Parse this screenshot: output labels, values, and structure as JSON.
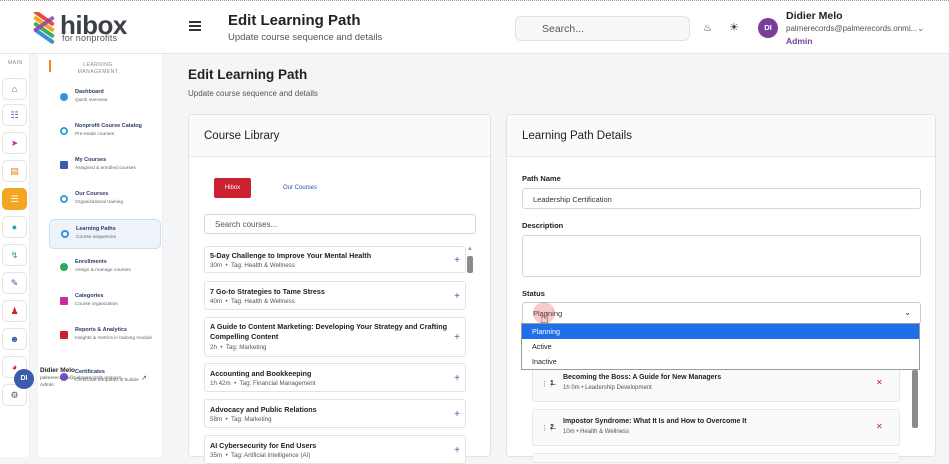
{
  "header": {
    "logo_text": "hibox",
    "logo_tag": "for nonprofits",
    "title": "Edit Learning Path",
    "subtitle": "Update course sequence and details",
    "search_placeholder": "Search...",
    "user_initials": "DI",
    "user_name": "Didier Melo",
    "user_email": "palmerecords@palmerecords.onmi...",
    "user_role": "Admin"
  },
  "rail": {
    "label": "MAIN",
    "icons": [
      "home-icon",
      "sitemap-icon",
      "rocket-icon",
      "book-icon",
      "layers-icon",
      "target-icon",
      "flow-icon",
      "form-icon",
      "user-minus-icon",
      "users-icon",
      "chart-pie-icon",
      "gear-icon"
    ]
  },
  "sidenav": {
    "heading": "LEARNING MANAGEMENT",
    "items": [
      {
        "title": "Dashboard",
        "sub": "Quick overview",
        "color": "#3b8fd9",
        "active": false
      },
      {
        "title": "Nonprofit Course Catalog",
        "sub": "Pre-made courses",
        "color": "#2fa4d6",
        "active": false
      },
      {
        "title": "My Courses",
        "sub": "Assigned & enrolled courses",
        "color": "#3b5bab",
        "active": false
      },
      {
        "title": "Our Courses",
        "sub": "Organizational training",
        "color": "#2fa4d6",
        "active": false
      },
      {
        "title": "Learning Paths",
        "sub": "Course sequences",
        "color": "#3b8fd9",
        "active": true
      },
      {
        "title": "Enrollments",
        "sub": "Assign & manage courses",
        "color": "#2fa85a",
        "active": false
      },
      {
        "title": "Categories",
        "sub": "Course organization",
        "color": "#cc2a9c",
        "active": false
      },
      {
        "title": "Reports & Analytics",
        "sub": "Insights & metrics in training module",
        "color": "#cc2131",
        "active": false
      },
      {
        "title": "Certificates",
        "sub": "Certificate templates & builder",
        "color": "#7a4ed1",
        "active": false
      }
    ],
    "user_initials": "DI",
    "user_name": "Didier Melo",
    "user_email": "palmerecords@palmerecords.onmicro...",
    "user_role": "Admin"
  },
  "main": {
    "title": "Edit Learning Path",
    "subtitle": "Update course sequence and details"
  },
  "library": {
    "title": "Course Library",
    "tabs": [
      "Hibox",
      "Our Courses"
    ],
    "search_placeholder": "Search courses...",
    "courses": [
      {
        "name": "5-Day Challenge to Improve Your Mental Health",
        "duration": "30m",
        "tag": "Tag: Health & Wellness"
      },
      {
        "name": "7 Go-to Strategies to Tame Stress",
        "duration": "40m",
        "tag": "Tag: Health & Wellness"
      },
      {
        "name": "A Guide to Content Marketing: Developing Your Strategy and Crafting Compelling Content",
        "duration": "2h",
        "tag": "Tag: Marketing"
      },
      {
        "name": "Accounting and Bookkeeping",
        "duration": "1h 42m",
        "tag": "Tag: Financial Management"
      },
      {
        "name": "Advocacy and Public Relations",
        "duration": "58m",
        "tag": "Tag: Marketing"
      },
      {
        "name": "AI Cybersecurity for End Users",
        "duration": "35m",
        "tag": "Tag: Artificial Intelligence (AI)"
      }
    ]
  },
  "path": {
    "title": "Learning Path Details",
    "name_label": "Path Name",
    "name_value": "Leadership Certification",
    "description_label": "Description",
    "description_value": "",
    "status_label": "Status",
    "status_value": "Planning",
    "status_options": [
      "Planning",
      "Active",
      "Inactive"
    ],
    "selected_option": "Planning",
    "sequence": [
      {
        "num": "1.",
        "title": "Becoming the Boss: A Guide for New Managers",
        "meta": "1h 0m • Leadership Development"
      },
      {
        "num": "2.",
        "title": "Impostor Syndrome: What It Is and How to Overcome It",
        "meta": "10m • Health & Wellness"
      }
    ]
  },
  "colors": {
    "accent_red": "#cc2131",
    "accent_blue": "#2b4fb5",
    "admin_purple": "#7a3e98",
    "dropdown_highlight": "#1f6feb"
  }
}
